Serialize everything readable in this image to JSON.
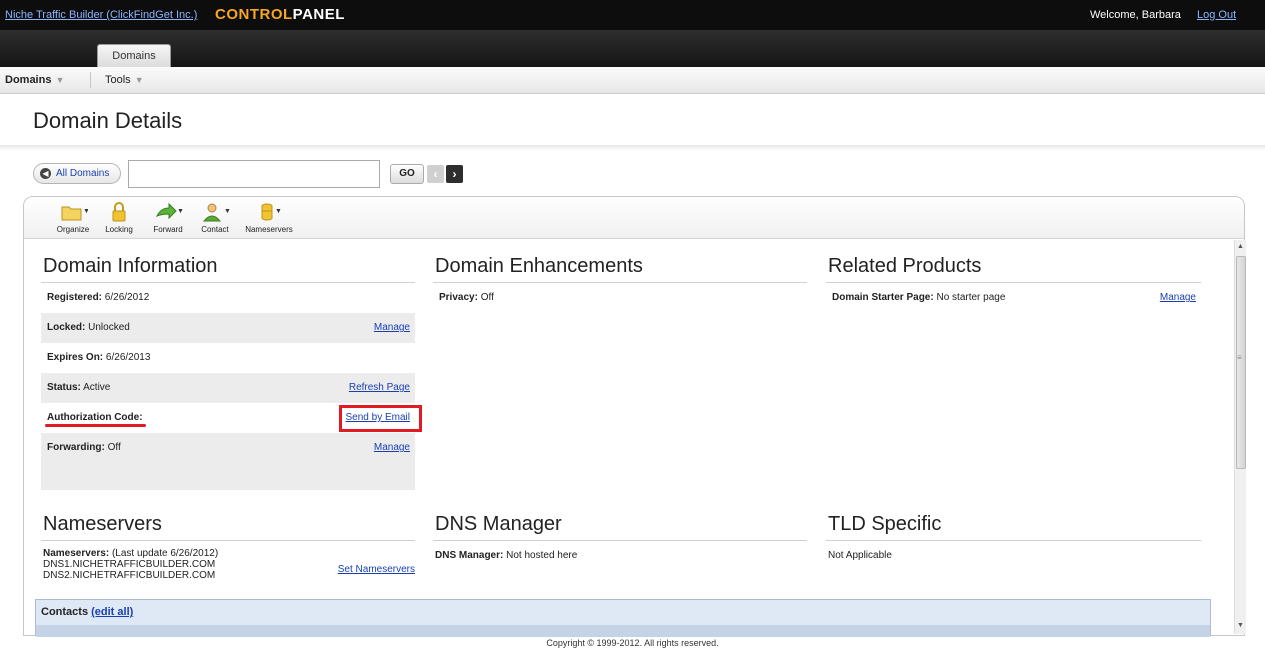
{
  "topbar": {
    "brand_link": "Niche Traffic Builder (ClickFindGet Inc.)",
    "logo_prefix": "CONTROL",
    "logo_suffix": "PANEL",
    "welcome": "Welcome, Barbara",
    "logout": "Log Out"
  },
  "tabs": [
    {
      "label": "Domains"
    }
  ],
  "menu": [
    {
      "label": "Domains"
    },
    {
      "label": "Tools"
    }
  ],
  "page_title": "Domain Details",
  "search": {
    "all_domains": "All Domains",
    "value": "",
    "go": "GO"
  },
  "toolbar": [
    {
      "label": "Organize",
      "icon": "folder-icon"
    },
    {
      "label": "Locking",
      "icon": "lock-icon"
    },
    {
      "label": "Forward",
      "icon": "forward-arrow-icon"
    },
    {
      "label": "Contact",
      "icon": "contact-person-icon"
    },
    {
      "label": "Nameservers",
      "icon": "database-icon"
    }
  ],
  "domain_info": {
    "title": "Domain Information",
    "rows": [
      {
        "label": "Registered:",
        "value": "6/26/2012",
        "action": ""
      },
      {
        "label": "Locked:",
        "value": "Unlocked",
        "action": "Manage"
      },
      {
        "label": "Expires On:",
        "value": "6/26/2013",
        "action": ""
      },
      {
        "label": "Status:",
        "value": "Active",
        "action": "Refresh Page"
      },
      {
        "label": "Authorization Code:",
        "value": "",
        "action": "Send by Email"
      },
      {
        "label": "Forwarding:",
        "value": "Off",
        "action": "Manage"
      }
    ]
  },
  "enhancements": {
    "title": "Domain Enhancements",
    "privacy_label": "Privacy:",
    "privacy_value": "Off"
  },
  "related": {
    "title": "Related Products",
    "starter_label": "Domain Starter Page:",
    "starter_value": "No starter page",
    "action": "Manage"
  },
  "nameservers": {
    "title": "Nameservers",
    "label": "Nameservers:",
    "updated": "(Last update 6/26/2012)",
    "ns1": "DNS1.NICHETRAFFICBUILDER.COM",
    "ns2": "DNS2.NICHETRAFFICBUILDER.COM",
    "action": "Set Nameservers"
  },
  "dns": {
    "title": "DNS Manager",
    "label": "DNS Manager:",
    "value": "Not hosted here"
  },
  "tld": {
    "title": "TLD Specific",
    "value": "Not Applicable"
  },
  "contacts": {
    "label": "Contacts",
    "edit_all": "(edit all)"
  },
  "footer": "Copyright © 1999-2012. All rights reserved.",
  "colors": {
    "link": "#1a3fb0",
    "highlight": "#e01b24",
    "logo_accent": "#f5a623"
  }
}
